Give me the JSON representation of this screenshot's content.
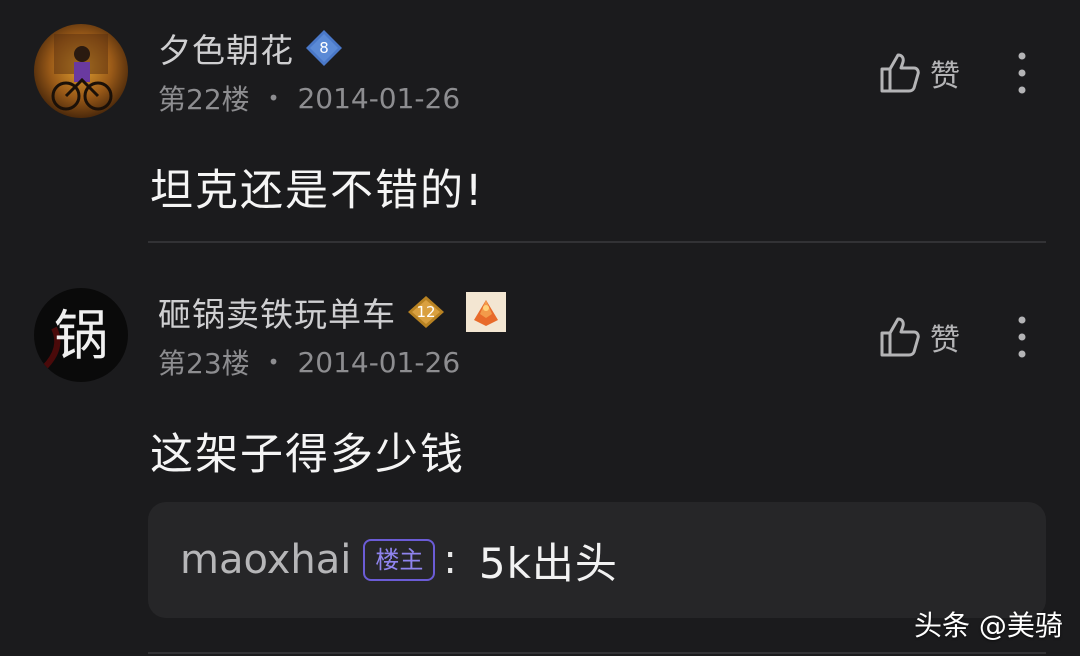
{
  "posts": [
    {
      "username": "夕色朝花",
      "level": "8",
      "floor": "第22楼",
      "date": "2014-01-26",
      "like_label": "赞",
      "comment": "坦克还是不错的!"
    },
    {
      "username": "砸锅卖铁玩单车",
      "level": "12",
      "floor": "第23楼",
      "date": "2014-01-26",
      "like_label": "赞",
      "comment": "这架子得多少钱",
      "reply": {
        "user": "maoxhai",
        "badge": "楼主",
        "colon": ":",
        "text": "5k出头"
      }
    }
  ],
  "meta_separator": "•",
  "watermark": "头条 @美骑",
  "avatar_text": "锅",
  "colors": {
    "background": "#1b1b1d",
    "level_badge_blue": "#4a78c8",
    "level_badge_gold": "#c9922f",
    "op_badge": "#6b5cd6",
    "reply_box": "#262628"
  },
  "icons": [
    "thumbs-up-icon",
    "more-vertical-icon",
    "level-badge-icon",
    "medal-icon"
  ]
}
